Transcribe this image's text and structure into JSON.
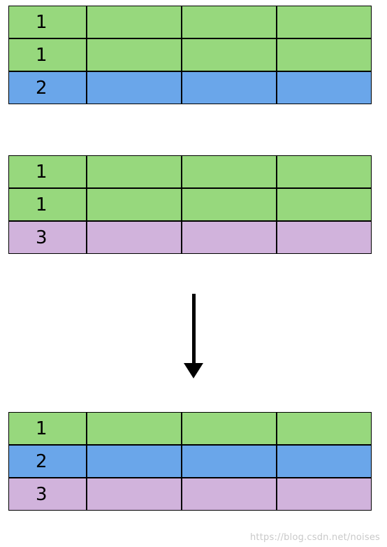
{
  "colors": {
    "green": "#97d87d",
    "blue": "#6aa6ea",
    "purple": "#d1b3dc"
  },
  "tables": {
    "t1": {
      "rows": [
        {
          "label": "1",
          "color": "green"
        },
        {
          "label": "1",
          "color": "green"
        },
        {
          "label": "2",
          "color": "blue"
        }
      ]
    },
    "t2": {
      "rows": [
        {
          "label": "1",
          "color": "green"
        },
        {
          "label": "1",
          "color": "green"
        },
        {
          "label": "3",
          "color": "purple"
        }
      ]
    },
    "t3": {
      "rows": [
        {
          "label": "1",
          "color": "green"
        },
        {
          "label": "2",
          "color": "blue"
        },
        {
          "label": "3",
          "color": "purple"
        }
      ]
    }
  },
  "watermark": "https://blog.csdn.net/noises"
}
